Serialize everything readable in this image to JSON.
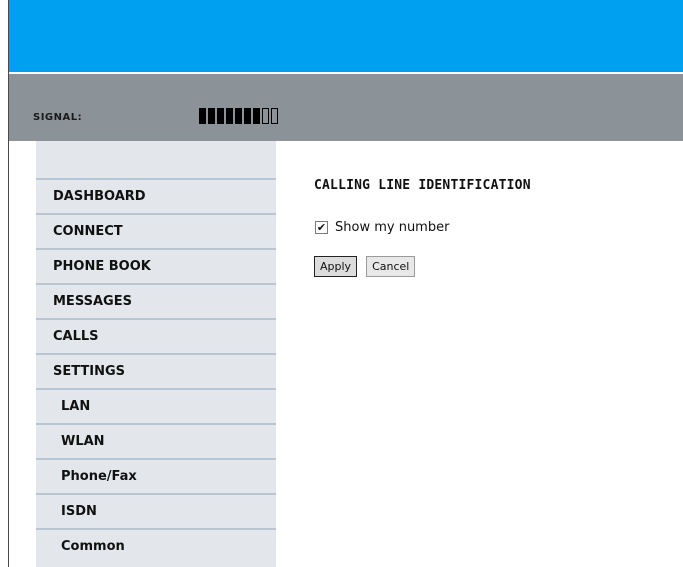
{
  "signal": {
    "label": "SIGNAL:",
    "level": 7,
    "max": 9
  },
  "nav": [
    {
      "label": "DASHBOARD",
      "sub": false
    },
    {
      "label": "CONNECT",
      "sub": false
    },
    {
      "label": "PHONE BOOK",
      "sub": false
    },
    {
      "label": "MESSAGES",
      "sub": false
    },
    {
      "label": "CALLS",
      "sub": false
    },
    {
      "label": "SETTINGS",
      "sub": false
    },
    {
      "label": "LAN",
      "sub": true
    },
    {
      "label": "WLAN",
      "sub": true
    },
    {
      "label": "Phone/Fax",
      "sub": true
    },
    {
      "label": "ISDN",
      "sub": true
    },
    {
      "label": "Common",
      "sub": true
    }
  ],
  "main": {
    "title": "CALLING LINE IDENTIFICATION",
    "show_number": {
      "label": "Show my number",
      "checked": true
    },
    "buttons": {
      "apply": "Apply",
      "cancel": "Cancel"
    }
  },
  "colors": {
    "header": "#00a0f0",
    "signal_bar": "#8c9398",
    "sidebar": "#e3e7eb",
    "sidebar_divider": "#b9c6d2"
  }
}
